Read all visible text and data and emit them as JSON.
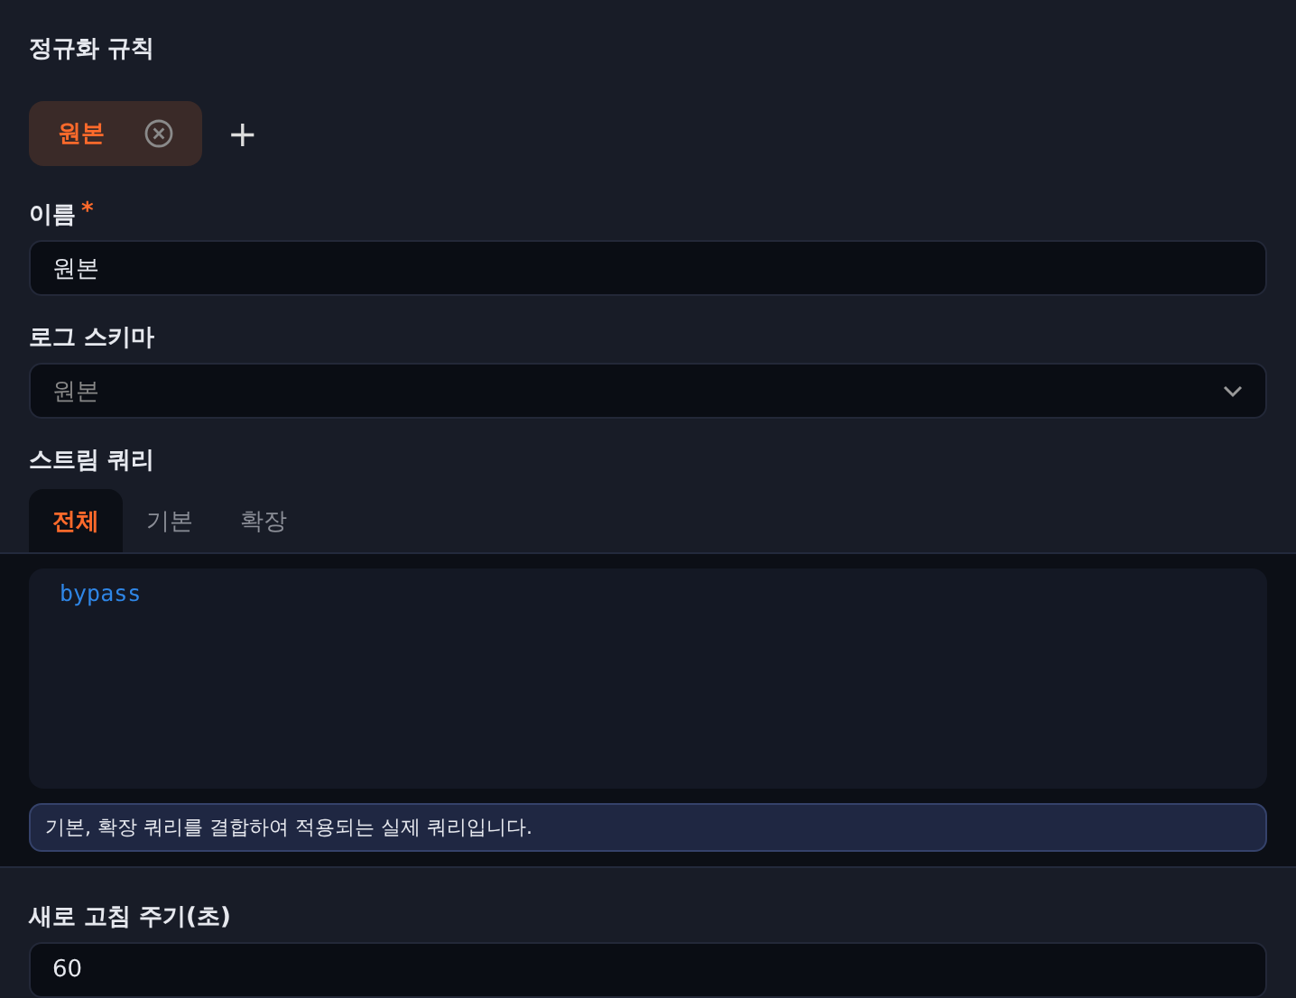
{
  "title": "정규화 규칙",
  "rules": [
    {
      "label": "원본",
      "selected": true
    }
  ],
  "add_button": "+",
  "name_field": {
    "label": "이름",
    "required_mark": "*",
    "value": "원본"
  },
  "schema_field": {
    "label": "로그 스키마",
    "value": "원본"
  },
  "stream_query": {
    "label": "스트림 쿼리",
    "tabs": [
      {
        "label": "전체",
        "selected": true
      },
      {
        "label": "기본",
        "selected": false
      },
      {
        "label": "확장",
        "selected": false
      }
    ],
    "query": "bypass",
    "note": "기본, 확장 쿼리를 결합하여 적용되는 실제 쿼리입니다."
  },
  "refresh_field": {
    "label": "새로 고침 주기(초)",
    "value": "60"
  }
}
